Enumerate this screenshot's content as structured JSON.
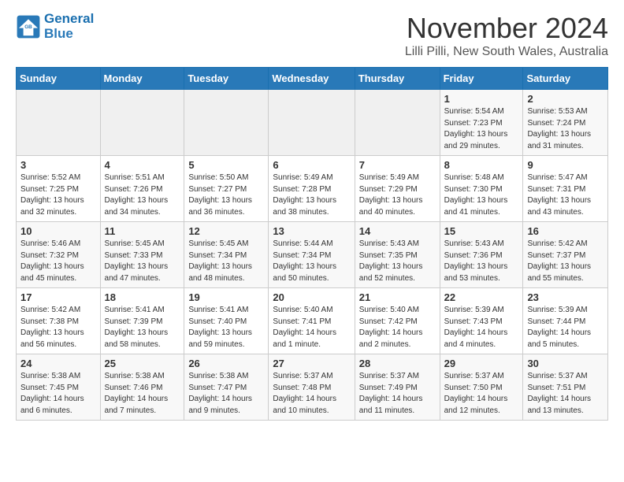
{
  "header": {
    "logo_line1": "General",
    "logo_line2": "Blue",
    "title": "November 2024",
    "subtitle": "Lilli Pilli, New South Wales, Australia"
  },
  "calendar": {
    "days_of_week": [
      "Sunday",
      "Monday",
      "Tuesday",
      "Wednesday",
      "Thursday",
      "Friday",
      "Saturday"
    ],
    "weeks": [
      [
        {
          "day": "",
          "info": ""
        },
        {
          "day": "",
          "info": ""
        },
        {
          "day": "",
          "info": ""
        },
        {
          "day": "",
          "info": ""
        },
        {
          "day": "",
          "info": ""
        },
        {
          "day": "1",
          "info": "Sunrise: 5:54 AM\nSunset: 7:23 PM\nDaylight: 13 hours\nand 29 minutes."
        },
        {
          "day": "2",
          "info": "Sunrise: 5:53 AM\nSunset: 7:24 PM\nDaylight: 13 hours\nand 31 minutes."
        }
      ],
      [
        {
          "day": "3",
          "info": "Sunrise: 5:52 AM\nSunset: 7:25 PM\nDaylight: 13 hours\nand 32 minutes."
        },
        {
          "day": "4",
          "info": "Sunrise: 5:51 AM\nSunset: 7:26 PM\nDaylight: 13 hours\nand 34 minutes."
        },
        {
          "day": "5",
          "info": "Sunrise: 5:50 AM\nSunset: 7:27 PM\nDaylight: 13 hours\nand 36 minutes."
        },
        {
          "day": "6",
          "info": "Sunrise: 5:49 AM\nSunset: 7:28 PM\nDaylight: 13 hours\nand 38 minutes."
        },
        {
          "day": "7",
          "info": "Sunrise: 5:49 AM\nSunset: 7:29 PM\nDaylight: 13 hours\nand 40 minutes."
        },
        {
          "day": "8",
          "info": "Sunrise: 5:48 AM\nSunset: 7:30 PM\nDaylight: 13 hours\nand 41 minutes."
        },
        {
          "day": "9",
          "info": "Sunrise: 5:47 AM\nSunset: 7:31 PM\nDaylight: 13 hours\nand 43 minutes."
        }
      ],
      [
        {
          "day": "10",
          "info": "Sunrise: 5:46 AM\nSunset: 7:32 PM\nDaylight: 13 hours\nand 45 minutes."
        },
        {
          "day": "11",
          "info": "Sunrise: 5:45 AM\nSunset: 7:33 PM\nDaylight: 13 hours\nand 47 minutes."
        },
        {
          "day": "12",
          "info": "Sunrise: 5:45 AM\nSunset: 7:34 PM\nDaylight: 13 hours\nand 48 minutes."
        },
        {
          "day": "13",
          "info": "Sunrise: 5:44 AM\nSunset: 7:34 PM\nDaylight: 13 hours\nand 50 minutes."
        },
        {
          "day": "14",
          "info": "Sunrise: 5:43 AM\nSunset: 7:35 PM\nDaylight: 13 hours\nand 52 minutes."
        },
        {
          "day": "15",
          "info": "Sunrise: 5:43 AM\nSunset: 7:36 PM\nDaylight: 13 hours\nand 53 minutes."
        },
        {
          "day": "16",
          "info": "Sunrise: 5:42 AM\nSunset: 7:37 PM\nDaylight: 13 hours\nand 55 minutes."
        }
      ],
      [
        {
          "day": "17",
          "info": "Sunrise: 5:42 AM\nSunset: 7:38 PM\nDaylight: 13 hours\nand 56 minutes."
        },
        {
          "day": "18",
          "info": "Sunrise: 5:41 AM\nSunset: 7:39 PM\nDaylight: 13 hours\nand 58 minutes."
        },
        {
          "day": "19",
          "info": "Sunrise: 5:41 AM\nSunset: 7:40 PM\nDaylight: 13 hours\nand 59 minutes."
        },
        {
          "day": "20",
          "info": "Sunrise: 5:40 AM\nSunset: 7:41 PM\nDaylight: 14 hours\nand 1 minute."
        },
        {
          "day": "21",
          "info": "Sunrise: 5:40 AM\nSunset: 7:42 PM\nDaylight: 14 hours\nand 2 minutes."
        },
        {
          "day": "22",
          "info": "Sunrise: 5:39 AM\nSunset: 7:43 PM\nDaylight: 14 hours\nand 4 minutes."
        },
        {
          "day": "23",
          "info": "Sunrise: 5:39 AM\nSunset: 7:44 PM\nDaylight: 14 hours\nand 5 minutes."
        }
      ],
      [
        {
          "day": "24",
          "info": "Sunrise: 5:38 AM\nSunset: 7:45 PM\nDaylight: 14 hours\nand 6 minutes."
        },
        {
          "day": "25",
          "info": "Sunrise: 5:38 AM\nSunset: 7:46 PM\nDaylight: 14 hours\nand 7 minutes."
        },
        {
          "day": "26",
          "info": "Sunrise: 5:38 AM\nSunset: 7:47 PM\nDaylight: 14 hours\nand 9 minutes."
        },
        {
          "day": "27",
          "info": "Sunrise: 5:37 AM\nSunset: 7:48 PM\nDaylight: 14 hours\nand 10 minutes."
        },
        {
          "day": "28",
          "info": "Sunrise: 5:37 AM\nSunset: 7:49 PM\nDaylight: 14 hours\nand 11 minutes."
        },
        {
          "day": "29",
          "info": "Sunrise: 5:37 AM\nSunset: 7:50 PM\nDaylight: 14 hours\nand 12 minutes."
        },
        {
          "day": "30",
          "info": "Sunrise: 5:37 AM\nSunset: 7:51 PM\nDaylight: 14 hours\nand 13 minutes."
        }
      ]
    ]
  }
}
